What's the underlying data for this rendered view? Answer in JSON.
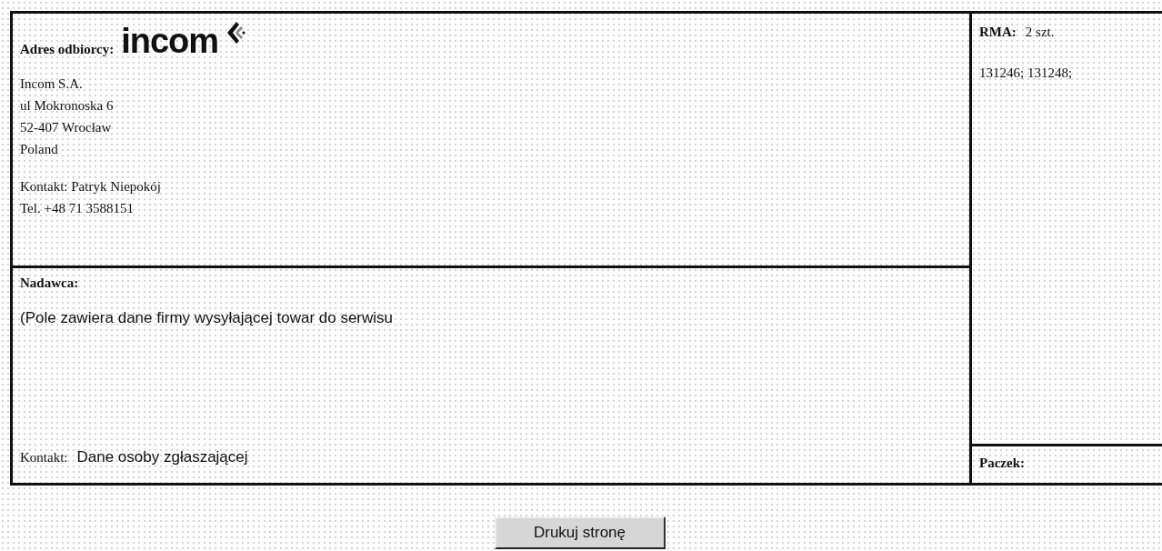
{
  "recipient": {
    "label": "Adres odbiorcy:",
    "logo_text": "incom",
    "address_lines": [
      "Incom S.A.",
      "ul Mokronoska 6",
      "52-407 Wrocław",
      "Poland"
    ],
    "contact": "Kontakt: Patryk Niepokój",
    "phone": "Tel. +48 71 3588151"
  },
  "sender": {
    "label": "Nadawca:",
    "description": "(Pole zawiera dane firmy wysyłającej towar do serwisu",
    "contact_label": "Kontakt:",
    "contact_value": "Dane osoby zgłaszającej"
  },
  "rma": {
    "label": "RMA:",
    "count": "2 szt.",
    "numbers": "131246; 131248;"
  },
  "parcels": {
    "label": "Paczek:"
  },
  "print_button": "Drukuj stronę"
}
